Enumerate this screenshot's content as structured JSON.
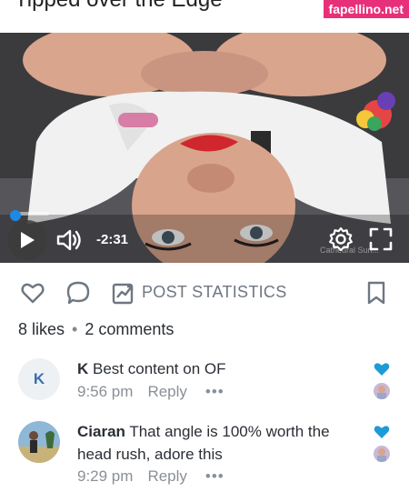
{
  "post": {
    "title": "Tipped over the Edge",
    "watermark": "fapellino.net"
  },
  "video": {
    "time_remaining": "-2:31",
    "credit": "Cathedral Sun...",
    "progress_fraction": 0.05,
    "icons": [
      "play-icon",
      "volume-icon",
      "gear-icon",
      "fullscreen-icon"
    ]
  },
  "actions": {
    "stats_label": "POST STATISTICS",
    "icons": [
      "heart-outline-icon",
      "comment-bubble-icon",
      "stats-chart-icon",
      "bookmark-icon"
    ]
  },
  "counts": {
    "likes": "8 likes",
    "separator": "•",
    "comments": "2 comments"
  },
  "comments": [
    {
      "avatar_letter": "K",
      "author": "K",
      "text": "Best content on OF",
      "time": "9:56 pm",
      "reply_label": "Reply",
      "more": "•••"
    },
    {
      "avatar_letter": "",
      "author": "Ciaran",
      "text": "That angle is 100% worth the head rush, adore this",
      "time": "9:29 pm",
      "reply_label": "Reply",
      "more": "•••"
    }
  ],
  "colors": {
    "accent": "#1e88e5",
    "heart_liked": "#1e9bd7",
    "watermark_bg": "#e8307a",
    "muted_text": "#8a9096"
  }
}
